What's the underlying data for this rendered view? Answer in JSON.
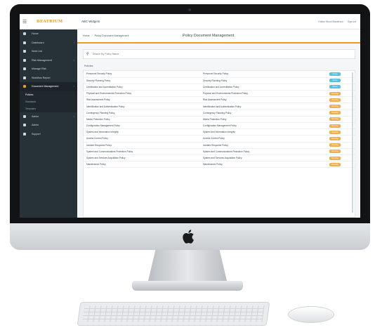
{
  "brand": {
    "logo_text": "BEATRIUM"
  },
  "topbar": {
    "app_title": "ABC Widgets",
    "user_label": "Hutton Wood Masterson",
    "signout_label": "Sign out"
  },
  "sidebar": {
    "items": [
      {
        "label": "Home",
        "has_caret": false
      },
      {
        "label": "Dashboard",
        "has_caret": true
      },
      {
        "label": "Work List",
        "has_caret": false
      },
      {
        "label": "Risk Management",
        "has_caret": true
      },
      {
        "label": "Manage Risk",
        "has_caret": false
      },
      {
        "label": "Workflow Report",
        "has_caret": false
      },
      {
        "label": "Document Management",
        "has_caret": true
      }
    ],
    "sub_items": [
      "Policies",
      "Standards",
      "Templates"
    ],
    "items_after": [
      {
        "label": "Admin",
        "has_caret": true
      },
      {
        "label": "Admin",
        "has_caret": false
      },
      {
        "label": "Support",
        "has_caret": false
      }
    ]
  },
  "breadcrumb": {
    "home": "Home",
    "current": "Policy Document Management"
  },
  "page_title": "Policy Document Management",
  "search": {
    "placeholder": "Search By Policy Name"
  },
  "section_label": "Policies",
  "table": {
    "rows": [
      {
        "name": "Personnel Security Policy",
        "alias": "Personnel Security Policy",
        "status": "Active"
      },
      {
        "name": "Security Planning Policy",
        "alias": "Security Planning Policy",
        "status": "Active"
      },
      {
        "name": "Certification and Accreditation Policy",
        "alias": "Certification and Accreditation Policy",
        "status": "Active"
      },
      {
        "name": "Physical and Environmental Protection Policy",
        "alias": "Physical and Environmental Protection Policy",
        "status": "Pending"
      },
      {
        "name": "Risk Assessment Policy",
        "alias": "Risk Assessment Policy",
        "status": "Pending"
      },
      {
        "name": "Identification and Authentication Policy",
        "alias": "Identification and Authentication Policy",
        "status": "Pending"
      },
      {
        "name": "Contingency Planning Policy",
        "alias": "Contingency Planning Policy",
        "status": "Pending"
      },
      {
        "name": "Media Protection Policy",
        "alias": "Media Protection Policy",
        "status": "Pending"
      },
      {
        "name": "Configuration Management Policy",
        "alias": "Configuration Management Policy",
        "status": "Pending"
      },
      {
        "name": "System and Information Integrity",
        "alias": "System and Information Integrity",
        "status": "Pending"
      },
      {
        "name": "Access Control Policy",
        "alias": "Access Control Policy",
        "status": "Pending"
      },
      {
        "name": "Incident Response Policy",
        "alias": "Incident Response Policy",
        "status": "Pending"
      },
      {
        "name": "System and Communications Protection Policy",
        "alias": "System and Communications Protection Policy",
        "status": "Pending"
      },
      {
        "name": "System and Services Acquisition Policy",
        "alias": "System and Services Acquisition Policy",
        "status": "Pending"
      },
      {
        "name": "Maintenance Policy",
        "alias": "Maintenance Policy",
        "status": "Pending"
      }
    ]
  },
  "colors": {
    "accent": "#f39c12",
    "sidebar": "#263238",
    "status_active": "#5bc0de",
    "status_pending": "#f0ad4e"
  }
}
